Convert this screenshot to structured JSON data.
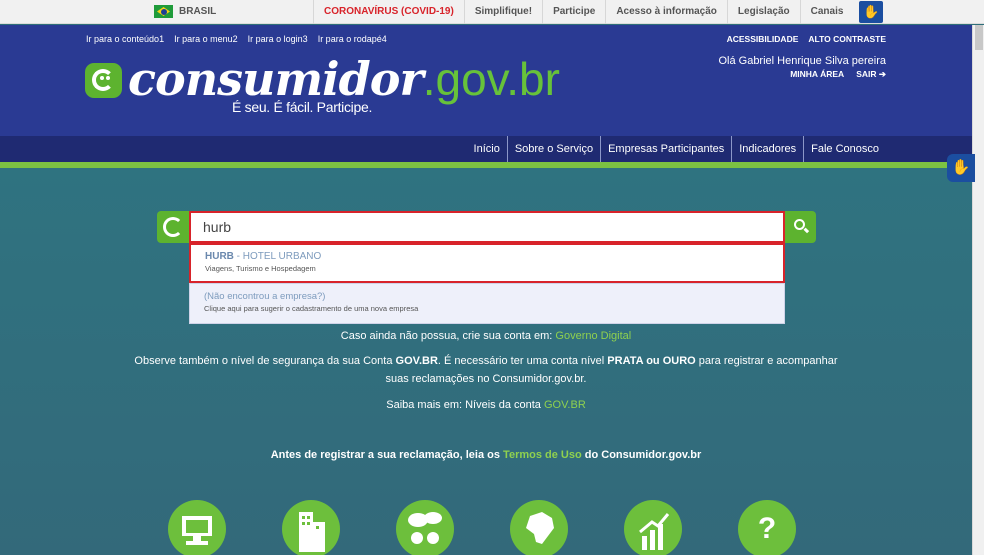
{
  "govbar": {
    "brasil": "BRASIL",
    "links": [
      "CORONAVÍRUS (COVID-19)",
      "Simplifique!",
      "Participe",
      "Acesso à informação",
      "Legislação",
      "Canais"
    ]
  },
  "header": {
    "skip_links": [
      {
        "label": "Ir para o conteúdo",
        "num": "1"
      },
      {
        "label": "Ir para o menu",
        "num": "2"
      },
      {
        "label": "Ir para o login",
        "num": "3"
      },
      {
        "label": "Ir para o rodapé",
        "num": "4"
      }
    ],
    "accessibility": "ACESSIBILIDADE",
    "high_contrast": "ALTO CONTRASTE",
    "logo_main": "consumidor",
    "logo_domain": ".gov.br",
    "tagline": "É seu. É fácil. Participe.",
    "greeting": "Olá  Gabriel Henrique Silva pereira",
    "my_area": "MINHA ÁREA",
    "logout": "SAIR"
  },
  "nav": [
    "Início",
    "Sobre o Serviço",
    "Empresas Participantes",
    "Indicadores",
    "Fale Conosco"
  ],
  "search": {
    "value": "hurb",
    "suggestion_title_bold": "HURB",
    "suggestion_title_rest": " - HOTEL URBANO",
    "suggestion_sub": "Viagens, Turismo e Hospedagem",
    "not_found_title": "(Não encontrou a empresa?)",
    "not_found_sub": "Clique aqui para sugerir o cadastramento de uma nova empresa"
  },
  "info": {
    "line1_pre": "Caso ainda não possua, crie sua conta em: ",
    "line1_link": "Governo Digital",
    "line2_a": "Observe também o nível de segurança da sua Conta ",
    "line2_b": "GOV.BR",
    "line2_c": ". É necessário ter uma conta nível ",
    "line2_d": "PRATA ou OURO",
    "line2_e": " para registrar e acompanhar",
    "line3": "suas reclamações no Consumidor.gov.br.",
    "line4_pre": "Saiba mais em: Níveis da conta ",
    "line4_link": "GOV.BR",
    "line5_pre": "Antes de registrar a sua reclamação, leia os ",
    "line5_link": "Termos de Uso",
    "line5_post": " do Consumidor.gov.br"
  },
  "categories": [
    "computer-icon",
    "building-icon",
    "chat-people-icon",
    "brazil-map-icon",
    "growth-chart-icon",
    "question-icon"
  ],
  "colors": {
    "header_blue": "#2a3a93",
    "brand_green": "#5db32f",
    "alert_red": "#d8232a"
  }
}
